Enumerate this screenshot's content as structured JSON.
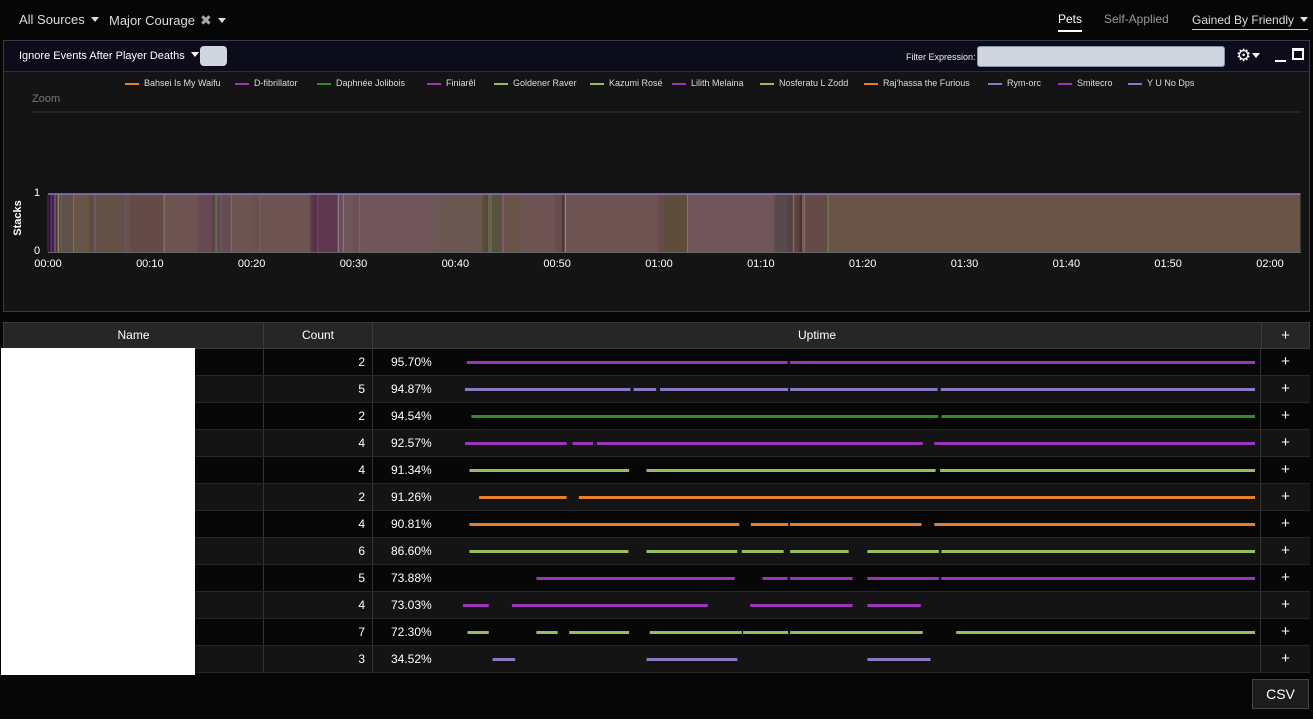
{
  "topbar": {
    "source_label": "All Sources",
    "buff_label": "Major Courage",
    "tab_pets": "Pets",
    "tab_self_applied": "Self-Applied",
    "gained_by": "Gained By Friendly"
  },
  "chart_panel": {
    "ignore_label": "Ignore Events After Player Deaths",
    "filter_label": "Filter Expression:",
    "filter_value": "",
    "zoom_label": "Zoom",
    "ylabel": "Stacks",
    "gear_icon": "gear-icon",
    "minimize_icon": "minimize-icon",
    "maximize_icon": "maximize-icon"
  },
  "colors": {
    "orange": "#e67f2d",
    "purple": "#9a36b8",
    "green": "#2f8c28",
    "lightgreen": "#98bd5c",
    "lavender": "#8c78c4",
    "magenta": "#b03ac8"
  },
  "chart_data": {
    "type": "area",
    "xlabel": "",
    "ylabel": "Stacks",
    "x_ticks": [
      "00:00",
      "00:10",
      "00:20",
      "00:30",
      "00:40",
      "00:50",
      "01:00",
      "01:10",
      "01:20",
      "01:30",
      "01:40",
      "01:50",
      "02:00"
    ],
    "y_ticks": [
      "0",
      "1"
    ],
    "xlim_seconds": [
      0,
      123
    ],
    "ylim": [
      0,
      1.6
    ],
    "legend_position": "top",
    "series": [
      {
        "name": "Bahsei Is My Waifu",
        "color": "#e67f2d"
      },
      {
        "name": "D-fibrillator",
        "color": "#9a36b8"
      },
      {
        "name": "Daphnée Jolibois",
        "color": "#2f8c28"
      },
      {
        "name": "Finiarêl",
        "color": "#9a36b8"
      },
      {
        "name": "Goldener Raver",
        "color": "#98bd5c"
      },
      {
        "name": "Kazumi Rosé",
        "color": "#98bd5c"
      },
      {
        "name": "Lilith Melaina",
        "color": "#9a36b8"
      },
      {
        "name": "Nosferatu L Zodd",
        "color": "#98bd5c"
      },
      {
        "name": "Raj'hassa the Furious",
        "color": "#e67f2d"
      },
      {
        "name": "Rym-orc",
        "color": "#8c78c4"
      },
      {
        "name": "Smitecro",
        "color": "#9a36b8"
      },
      {
        "name": "Y U No Dps",
        "color": "#8c78c4"
      }
    ]
  },
  "table": {
    "headers": {
      "name": "Name",
      "count": "Count",
      "uptime": "Uptime",
      "plus": "+"
    },
    "timeline_seconds": 123,
    "rows": [
      {
        "count": "2",
        "uptime": "95.70%",
        "color": "#9a36b8",
        "intervals": [
          [
            0.6,
            50.4
          ],
          [
            50.8,
            123
          ]
        ]
      },
      {
        "count": "5",
        "uptime": "94.87%",
        "color": "#8c78c4",
        "intervals": [
          [
            0.3,
            26
          ],
          [
            26.5,
            30
          ],
          [
            30.6,
            50.5
          ],
          [
            50.8,
            73.7
          ],
          [
            74.2,
            123
          ]
        ]
      },
      {
        "count": "2",
        "uptime": "94.54%",
        "color": "#2f8c28",
        "intervals": [
          [
            1.3,
            73.8
          ],
          [
            74.3,
            123
          ]
        ]
      },
      {
        "count": "4",
        "uptime": "92.57%",
        "color": "#9a36b8",
        "intervals": [
          [
            0.3,
            16.1
          ],
          [
            17,
            20.2
          ],
          [
            20.8,
            71.4
          ],
          [
            73.2,
            123
          ]
        ]
      },
      {
        "count": "4",
        "uptime": "91.34%",
        "color": "#98bd5c",
        "intervals": [
          [
            1,
            25.8
          ],
          [
            28.5,
            73.4
          ],
          [
            74.1,
            123
          ]
        ]
      },
      {
        "count": "2",
        "uptime": "91.26%",
        "color": "#e67f2d",
        "intervals": [
          [
            2.5,
            16.1
          ],
          [
            18,
            123
          ]
        ]
      },
      {
        "count": "4",
        "uptime": "90.81%",
        "color": "#e67f2d",
        "intervals": [
          [
            1,
            42.9
          ],
          [
            44.7,
            50.5
          ],
          [
            50.8,
            71.2
          ],
          [
            73.2,
            123
          ]
        ]
      },
      {
        "count": "6",
        "uptime": "86.60%",
        "color": "#98bd5c",
        "intervals": [
          [
            1,
            25.7
          ],
          [
            28.5,
            42.6
          ],
          [
            43.3,
            49.8
          ],
          [
            50.8,
            59.9
          ],
          [
            62.8,
            73.9
          ],
          [
            74.3,
            123
          ]
        ]
      },
      {
        "count": "5",
        "uptime": "73.88%",
        "color": "#9a36b8",
        "intervals": [
          [
            11.4,
            42.2
          ],
          [
            46.5,
            50.4
          ],
          [
            50.8,
            60.5
          ],
          [
            62.8,
            73.9
          ],
          [
            74.3,
            123
          ]
        ]
      },
      {
        "count": "4",
        "uptime": "73.03%",
        "color": "#9a36b8",
        "intervals": [
          [
            0,
            4
          ],
          [
            7.6,
            38
          ],
          [
            44.6,
            60.5
          ],
          [
            62.8,
            71.1
          ]
        ]
      },
      {
        "count": "7",
        "uptime": "72.30%",
        "color": "#98bd5c",
        "intervals": [
          [
            0.7,
            4
          ],
          [
            11.4,
            14.7
          ],
          [
            16.5,
            25.8
          ],
          [
            29,
            43.3
          ],
          [
            43.5,
            50.5
          ],
          [
            50.8,
            71.4
          ],
          [
            76.6,
            123
          ]
        ]
      },
      {
        "count": "3",
        "uptime": "34.52%",
        "color": "#8c78c4",
        "intervals": [
          [
            4.6,
            8.1
          ],
          [
            28.5,
            42.6
          ],
          [
            62.8,
            72.6
          ]
        ]
      }
    ]
  },
  "csv_label": "CSV"
}
